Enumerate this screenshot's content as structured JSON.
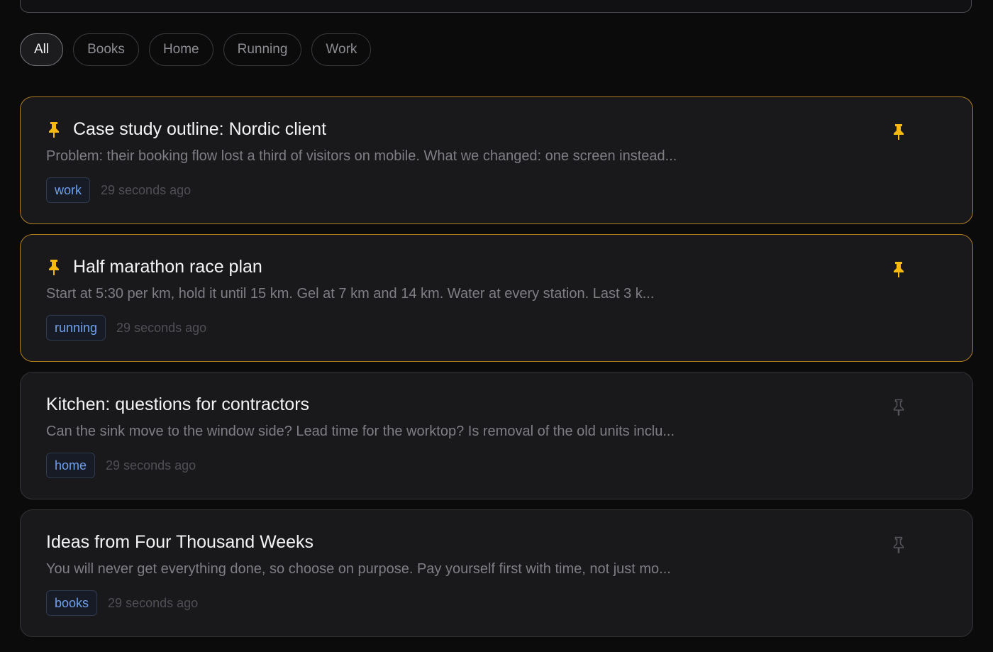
{
  "filters": [
    {
      "label": "All",
      "active": true
    },
    {
      "label": "Books",
      "active": false
    },
    {
      "label": "Home",
      "active": false
    },
    {
      "label": "Running",
      "active": false
    },
    {
      "label": "Work",
      "active": false
    }
  ],
  "notes": [
    {
      "title": "Case study outline: Nordic client",
      "preview": "Problem: their booking flow lost a third of visitors on mobile. What we changed: one screen instead...",
      "tag": "work",
      "time": "29 seconds ago",
      "pinned": true
    },
    {
      "title": "Half marathon race plan",
      "preview": "Start at 5:30 per km, hold it until 15 km. Gel at 7 km and 14 km. Water at every station. Last 3 k...",
      "tag": "running",
      "time": "29 seconds ago",
      "pinned": true
    },
    {
      "title": "Kitchen: questions for contractors",
      "preview": "Can the sink move to the window side? Lead time for the worktop? Is removal of the old units inclu...",
      "tag": "home",
      "time": "29 seconds ago",
      "pinned": false
    },
    {
      "title": "Ideas from Four Thousand Weeks",
      "preview": "You will never get everything done, so choose on purpose. Pay yourself first with time, not just mo...",
      "tag": "books",
      "time": "29 seconds ago",
      "pinned": false
    }
  ],
  "colors": {
    "pin_active": "#f5b90f",
    "pin_inactive": "#55555b",
    "pinned_border": "#b07d1f",
    "tag_text": "#6ea0f0"
  },
  "icons": {
    "pin_filled": "pin-filled-icon",
    "pin_outline": "pin-outline-icon"
  }
}
